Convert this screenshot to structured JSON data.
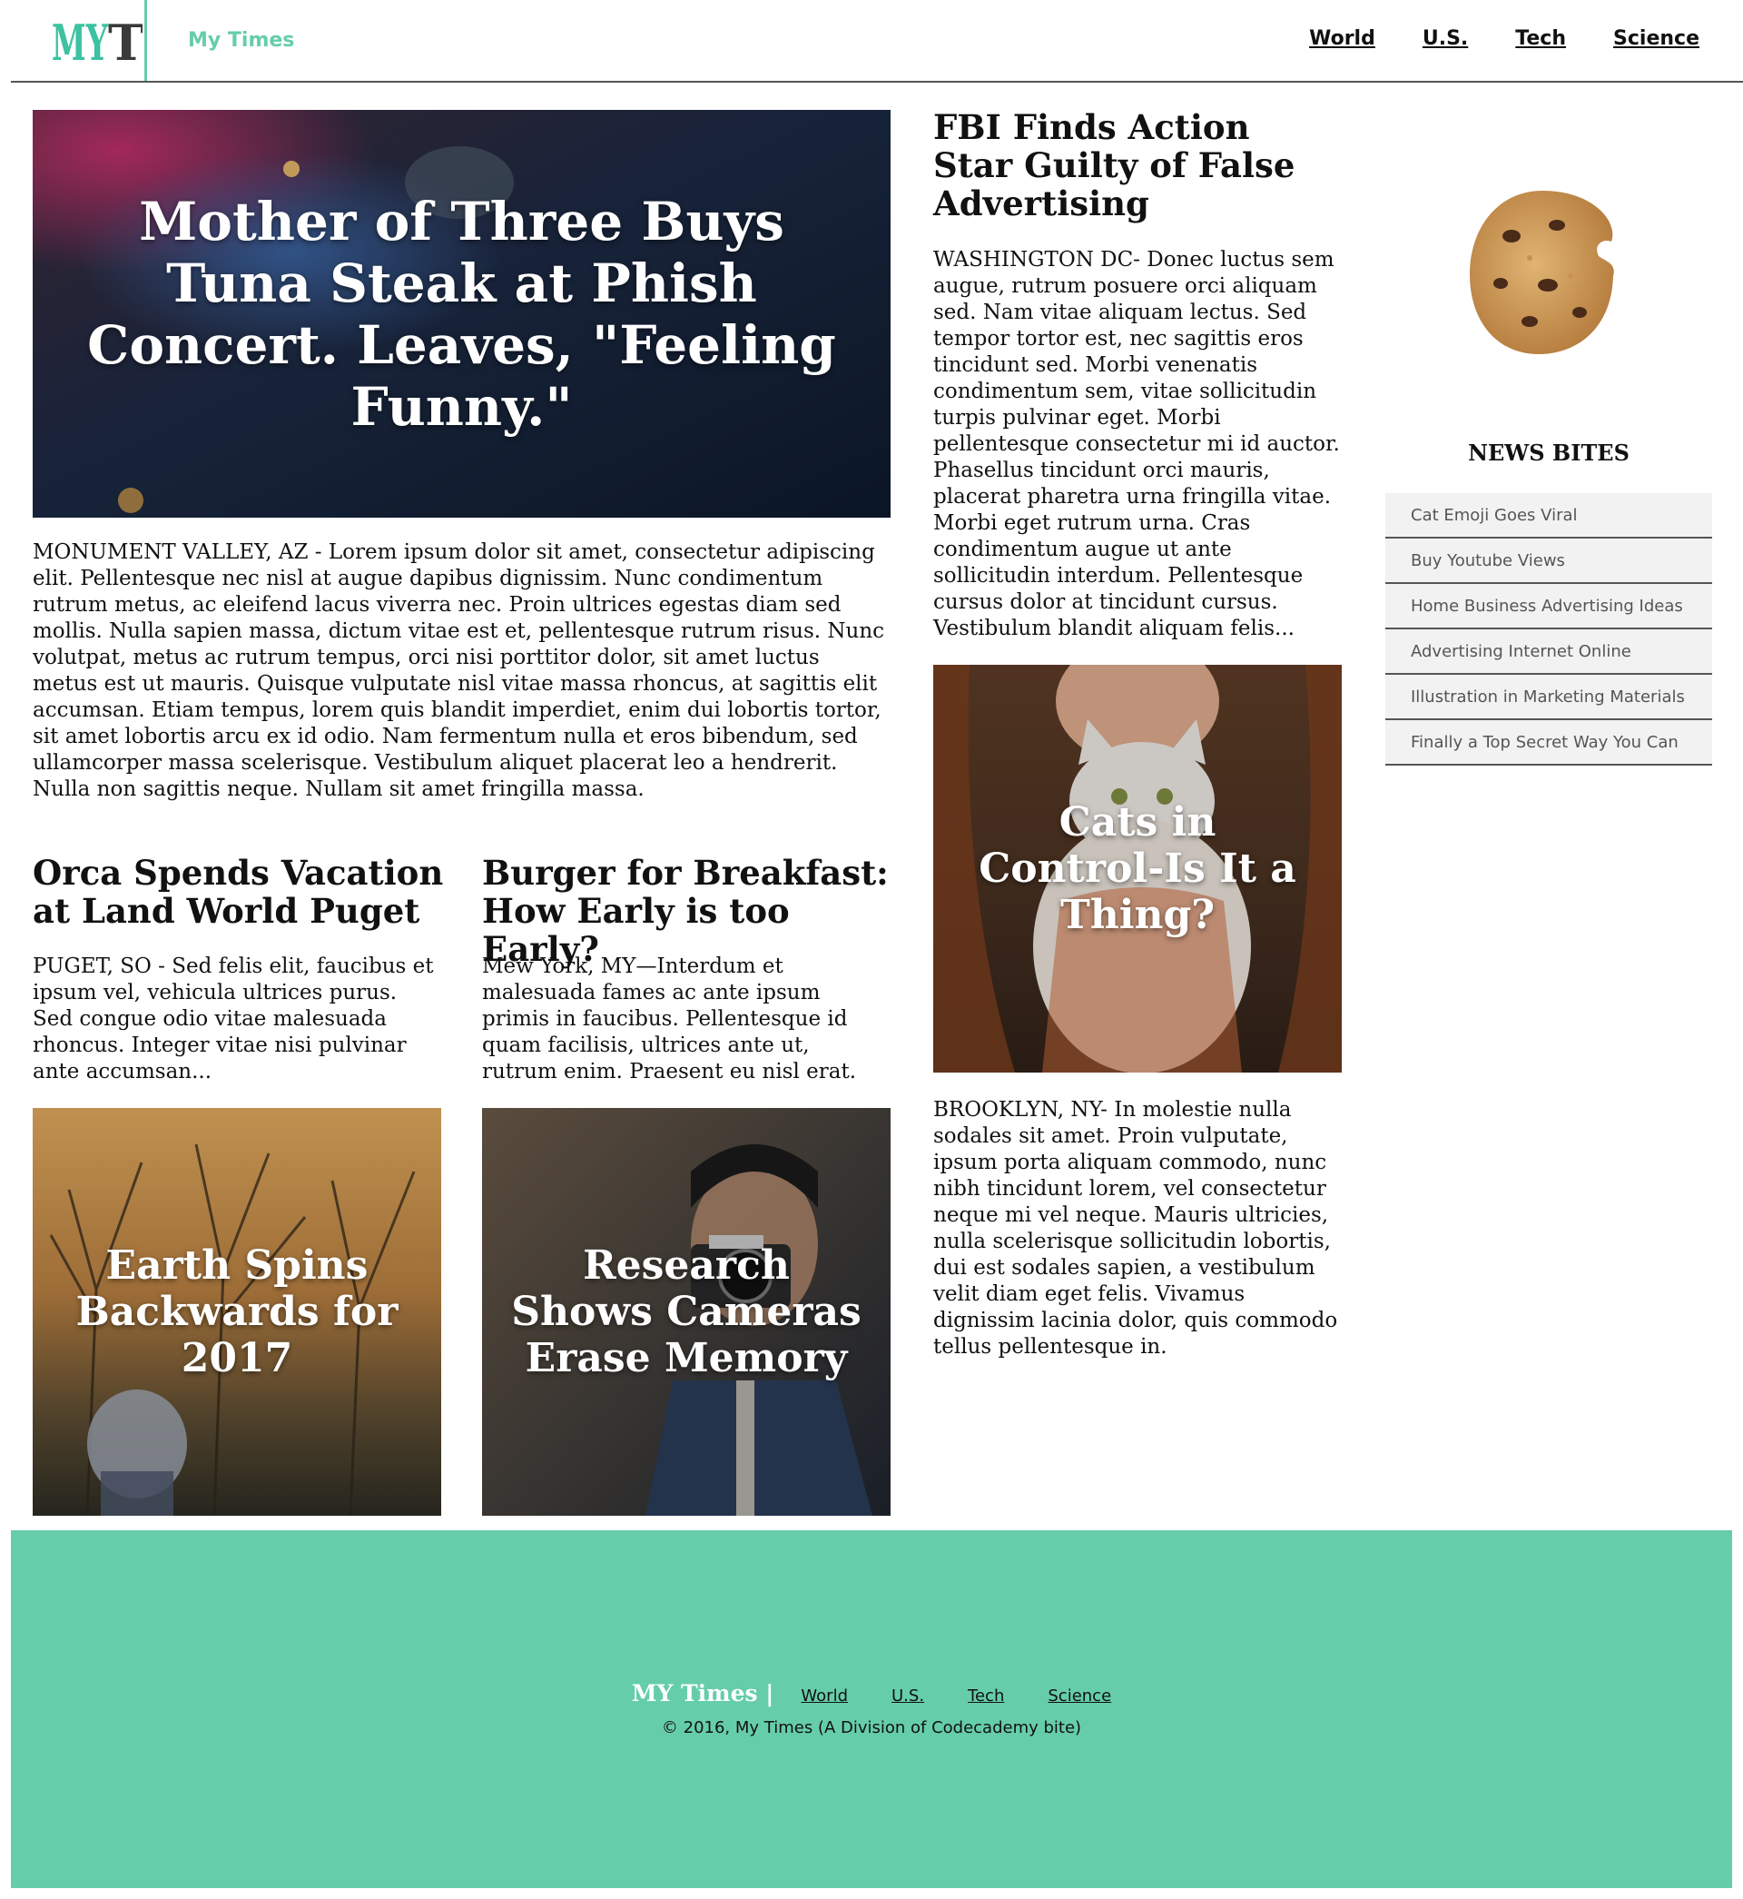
{
  "header": {
    "logo_text": "MYT",
    "brand_name": "My Times",
    "nav": [
      "World",
      "U.S.",
      "Tech",
      "Science"
    ]
  },
  "hero": {
    "title": "Mother of Three Buys Tuna Steak at Phish Concert. Leaves, \"Feeling Funny.\"",
    "body": "MONUMENT VALLEY, AZ - Lorem ipsum dolor sit amet, consectetur adipiscing elit. Pellentesque nec nisl at augue dapibus dignissim. Nunc condimentum rutrum metus, ac eleifend lacus viverra nec. Proin ultrices egestas diam sed mollis. Nulla sapien massa, dictum vitae est et, pellentesque rutrum risus. Nunc volutpat, metus ac rutrum tempus, orci nisi porttitor dolor, sit amet luctus metus est ut mauris. Quisque vulputate nisl vitae massa rhoncus, at sagittis elit accumsan. Etiam tempus, lorem quis blandit imperdiet, enim dui lobortis tortor, sit amet lobortis arcu ex id odio. Nam fermentum nulla et eros bibendum, sed ullamcorper massa scelerisque. Vestibulum aliquet placerat leo a hendrerit. Nulla non sagittis neque. Nullam sit amet fringilla massa."
  },
  "orca": {
    "title": "Orca Spends Vacation at Land World Puget",
    "body": "PUGET, SO - Sed felis elit, faucibus et ipsum vel, vehicula ultrices purus. Sed congue odio vitae malesuada rhoncus. Integer vitae nisi pulvinar ante accumsan..."
  },
  "burger": {
    "title": "Burger for Breakfast: How Early is too Early?",
    "body": "Mew York, MY—Interdum et malesuada fames ac ante ipsum primis in faucibus. Pellentesque id quam facilisis, ultrices ante ut, rutrum enim. Praesent eu nisl erat."
  },
  "earth": {
    "title": "Earth Spins Backwards for 2017"
  },
  "research": {
    "title": "Research Shows Cameras Erase Memory"
  },
  "fbi": {
    "title": "FBI Finds Action Star Guilty of False Advertising",
    "body": "WASHINGTON DC- Donec luctus sem augue, rutrum posuere orci aliquam sed. Nam vitae aliquam lectus. Sed tempor tortor est, nec sagittis eros tincidunt sed. Morbi venenatis condimentum sem, vitae sollicitudin turpis pulvinar eget. Morbi pellentesque consectetur mi id auctor. Phasellus tincidunt orci mauris, placerat pharetra urna fringilla vitae. Morbi eget rutrum urna. Cras condimentum augue ut ante sollicitudin interdum. Pellentesque cursus dolor at tincidunt cursus. Vestibulum blandit aliquam felis..."
  },
  "cats": {
    "title": "Cats in Control-Is It a Thing?",
    "body": "BROOKLYN, NY- In molestie nulla sodales sit amet. Proin vulputate, ipsum porta aliquam commodo, nunc nibh tincidunt lorem, vel consectetur neque mi vel neque. Mauris ultricies, nulla scelerisque sollicitudin lobortis, dui est sodales sapien, a vestibulum velit diam eget felis. Vivamus dignissim lacinia dolor, quis commodo tellus pellentesque in."
  },
  "sidebar": {
    "title": "NEWS BITES",
    "items": [
      "Cat Emoji Goes Viral",
      "Buy Youtube Views",
      "Home Business Advertising Ideas",
      "Advertising Internet Online",
      "Illustration in Marketing Materials",
      "Finally a Top Secret Way You Can"
    ]
  },
  "footer": {
    "brand": "MY Times |",
    "nav": [
      "World",
      "U.S.",
      "Tech",
      "Science"
    ],
    "copyright": "© 2016, My Times (A Division of Codecademy bite)"
  },
  "colors": {
    "accent": "#66cdaa",
    "footer_bg": "#66cdaa",
    "text": "#111111",
    "sidebar_item_bg": "#f2f2f2"
  }
}
